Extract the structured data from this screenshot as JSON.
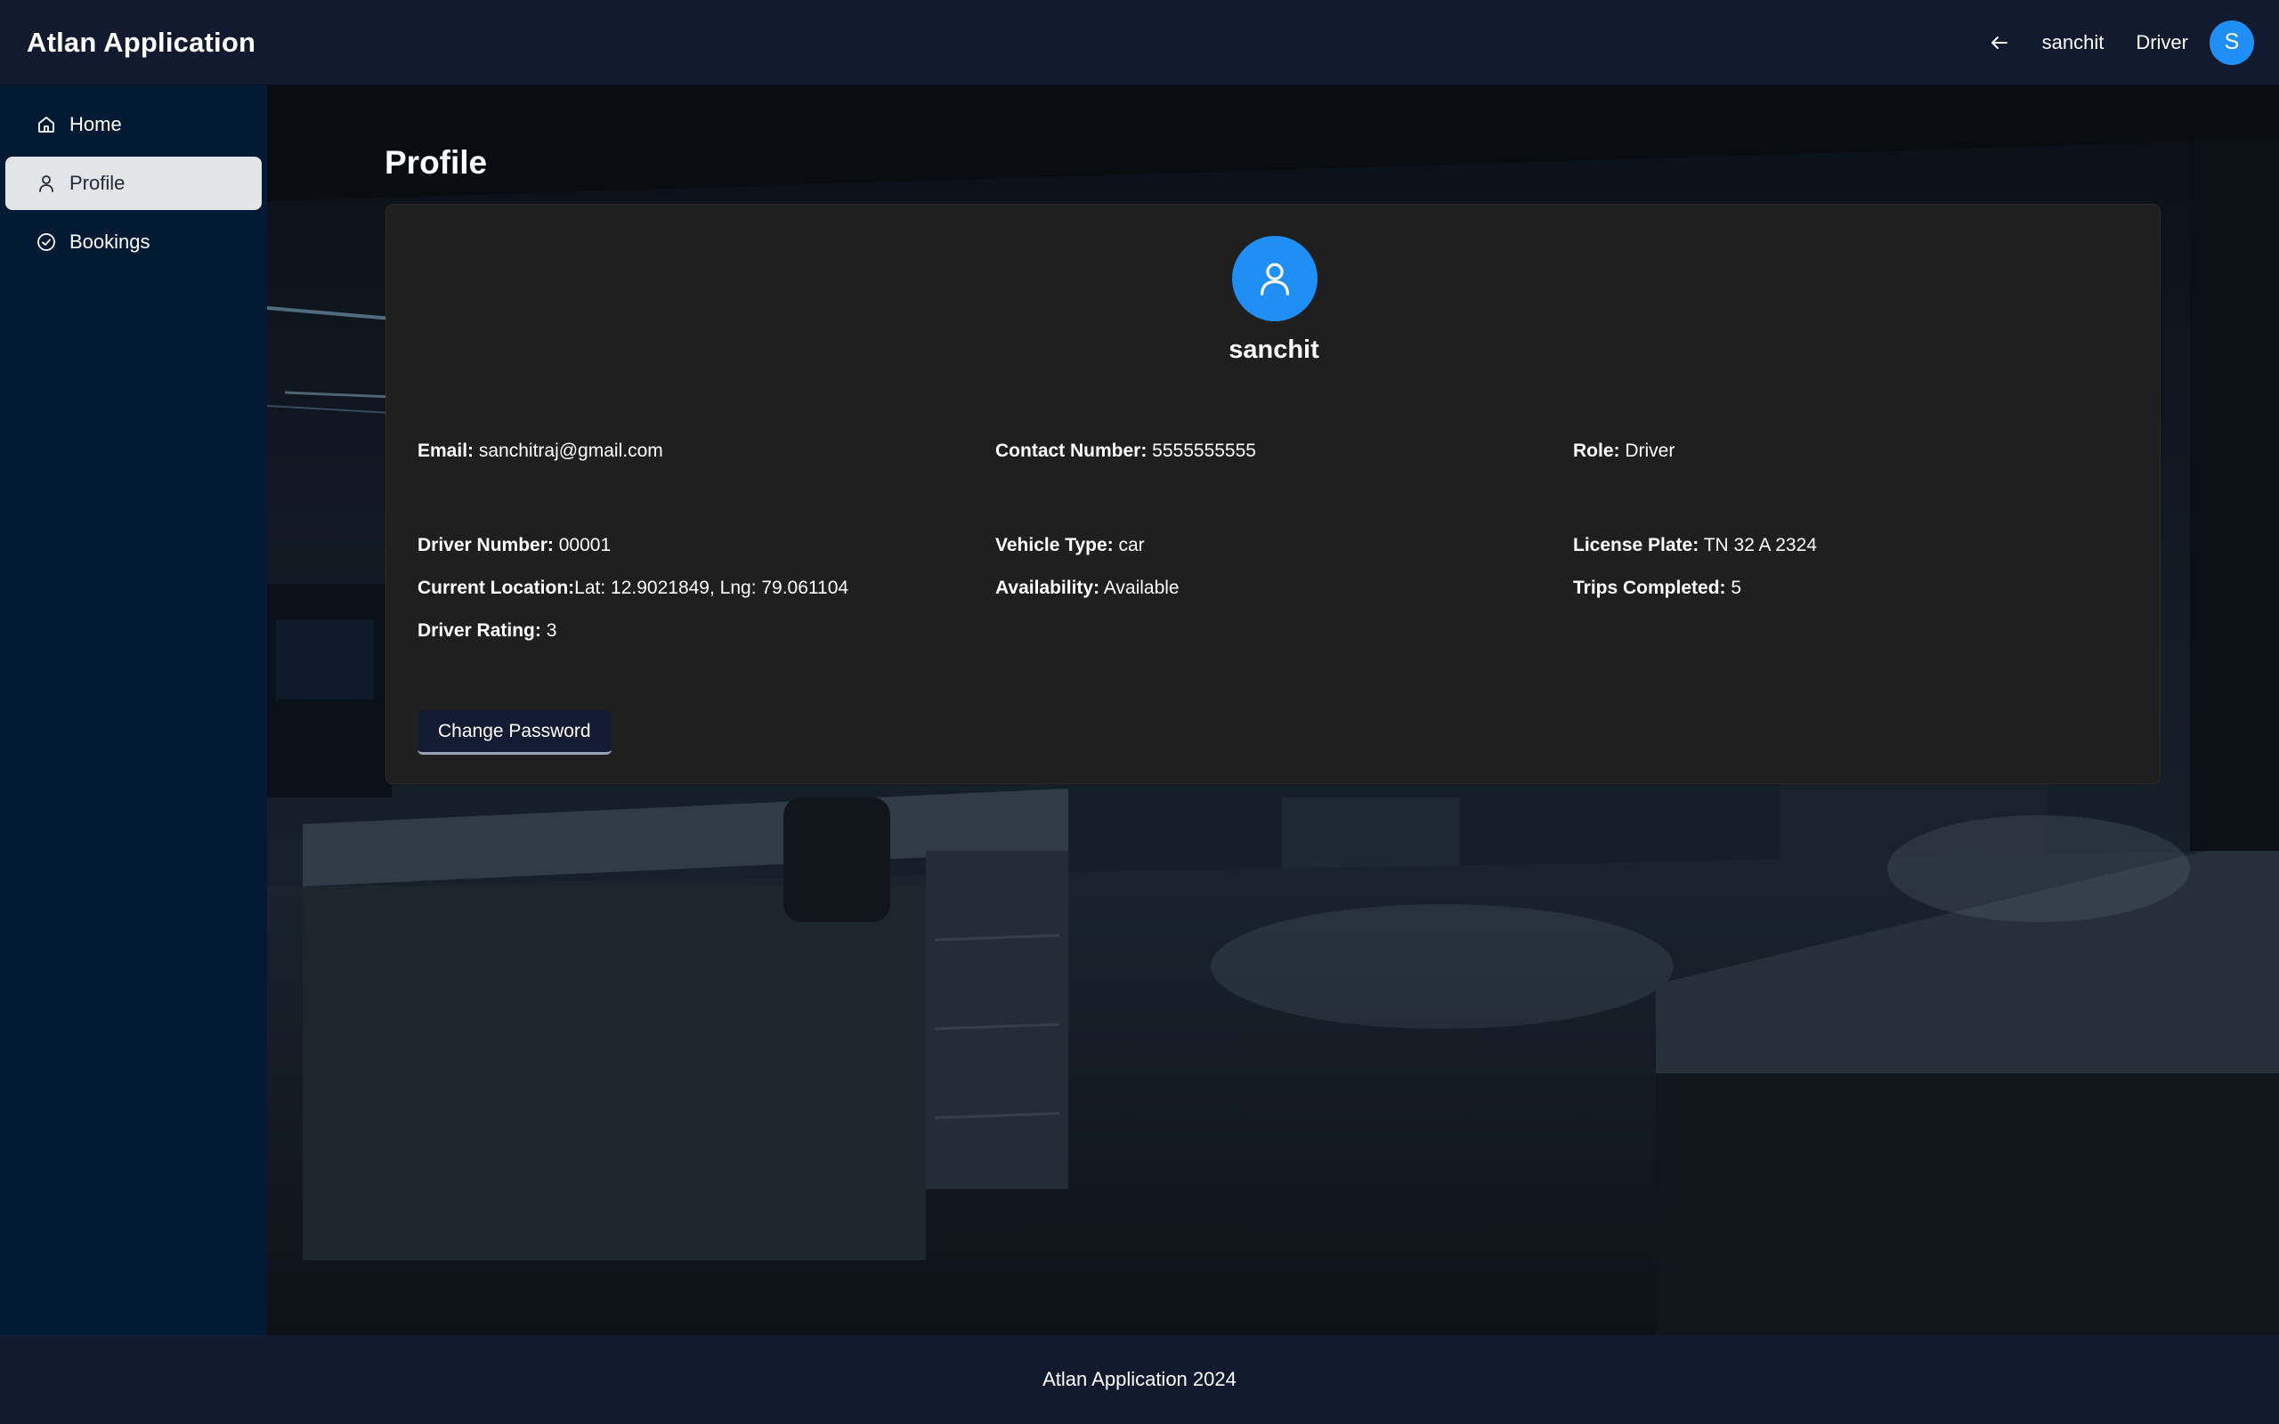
{
  "header": {
    "app_title": "Atlan Application",
    "back_icon": "arrow-left-icon",
    "username": "sanchit",
    "role": "Driver",
    "avatar_initial": "S"
  },
  "sidebar": {
    "items": [
      {
        "label": "Home",
        "icon": "home-icon",
        "active": false
      },
      {
        "label": "Profile",
        "icon": "user-icon",
        "active": true
      },
      {
        "label": "Bookings",
        "icon": "check-circle-icon",
        "active": false
      }
    ]
  },
  "main": {
    "title": "Profile",
    "profile": {
      "name": "sanchit",
      "avatar_icon": "user-icon",
      "fields": {
        "email": {
          "label": "Email:",
          "value": " sanchitraj@gmail.com"
        },
        "contact": {
          "label": "Contact Number:",
          "value": " 5555555555"
        },
        "role": {
          "label": "Role:",
          "value": " Driver"
        },
        "driver_number": {
          "label": "Driver Number:",
          "value": " 00001"
        },
        "vehicle_type": {
          "label": "Vehicle Type:",
          "value": " car"
        },
        "license_plate": {
          "label": "License Plate:",
          "value": " TN 32 A 2324"
        },
        "location": {
          "label": "Current Location:",
          "value": "Lat: 12.9021849, Lng: 79.061104"
        },
        "availability": {
          "label": "Availability:",
          "value": " Available"
        },
        "trips": {
          "label": "Trips Completed:",
          "value": " 5"
        },
        "rating": {
          "label": "Driver Rating:",
          "value": " 3"
        }
      },
      "change_password_label": "Change Password"
    }
  },
  "footer": {
    "text": "Atlan Application 2024"
  },
  "colors": {
    "accent": "#1f8ff5",
    "header_bg": "#111a2e",
    "sidebar_bg": "#021a33",
    "card_bg": "#1f1f1f",
    "active_nav_bg": "#e2e4e6"
  }
}
